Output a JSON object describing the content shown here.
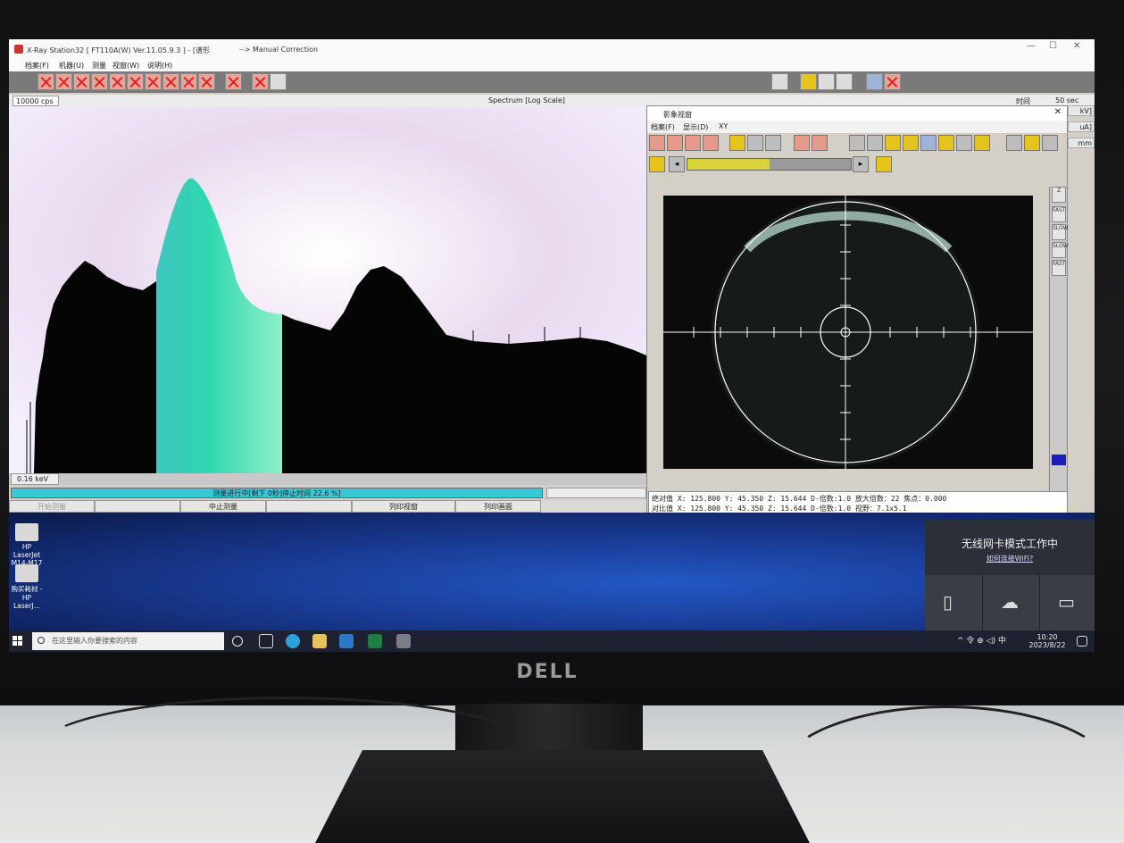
{
  "window": {
    "title": "X-Ray Station32 [ FT110A(W) Ver.11.05.9.3 ] - [谱形",
    "mode": "--> Manual Correction"
  },
  "menu": [
    "档案(F)",
    "机器(U)",
    "测量",
    "视窗(W)",
    "说明(H)"
  ],
  "spectrum": {
    "cps_label": "10000 cps",
    "title": "Spectrum [Log Scale]",
    "time_label": "时间",
    "time_value": "50 sec",
    "kev_label": "0.16 keV",
    "progress_text": "测量进行中[剩下  0秒]停止时间  22.6 %]",
    "progress_percent": 100,
    "buttons": {
      "start": "开始测量",
      "stop": "中止测量",
      "print_view": "列印视窗",
      "print_screen": "列印画面"
    }
  },
  "image_window": {
    "title": "影象视窗",
    "menu": [
      "档案(F)",
      "显示(D)",
      "XY"
    ],
    "side_buttons": [
      "Z",
      "FAST",
      "SLOW",
      "SLOW",
      "FAST"
    ],
    "readout_line1": "绝对值  X: 125.800 Y:  45.350 Z:  15.644  D-倍数:1.0  放大倍数：22  焦点：0.000",
    "readout_line2": "对比值  X: 125.800 Y:  45.350 Z:  15.644  D-倍数:1.0  视野：7.1x5.1",
    "slider_fill": 0.5
  },
  "right_units": [
    "kV]",
    "uA]",
    "mm"
  ],
  "desktop": {
    "icons": [
      {
        "label": "HP LaserJet M14-M17"
      },
      {
        "label": "购买耗材 - HP LaserJ..."
      }
    ],
    "wifi_title": "无线网卡模式工作中",
    "wifi_link": "如何连接WiFi?"
  },
  "taskbar": {
    "search_placeholder": "在这里输入你要搜索的内容",
    "tray": "^ 令 ⊕ ◁) 中",
    "time": "10:20",
    "date": "2023/8/22"
  },
  "bezel_brand": "DELL"
}
